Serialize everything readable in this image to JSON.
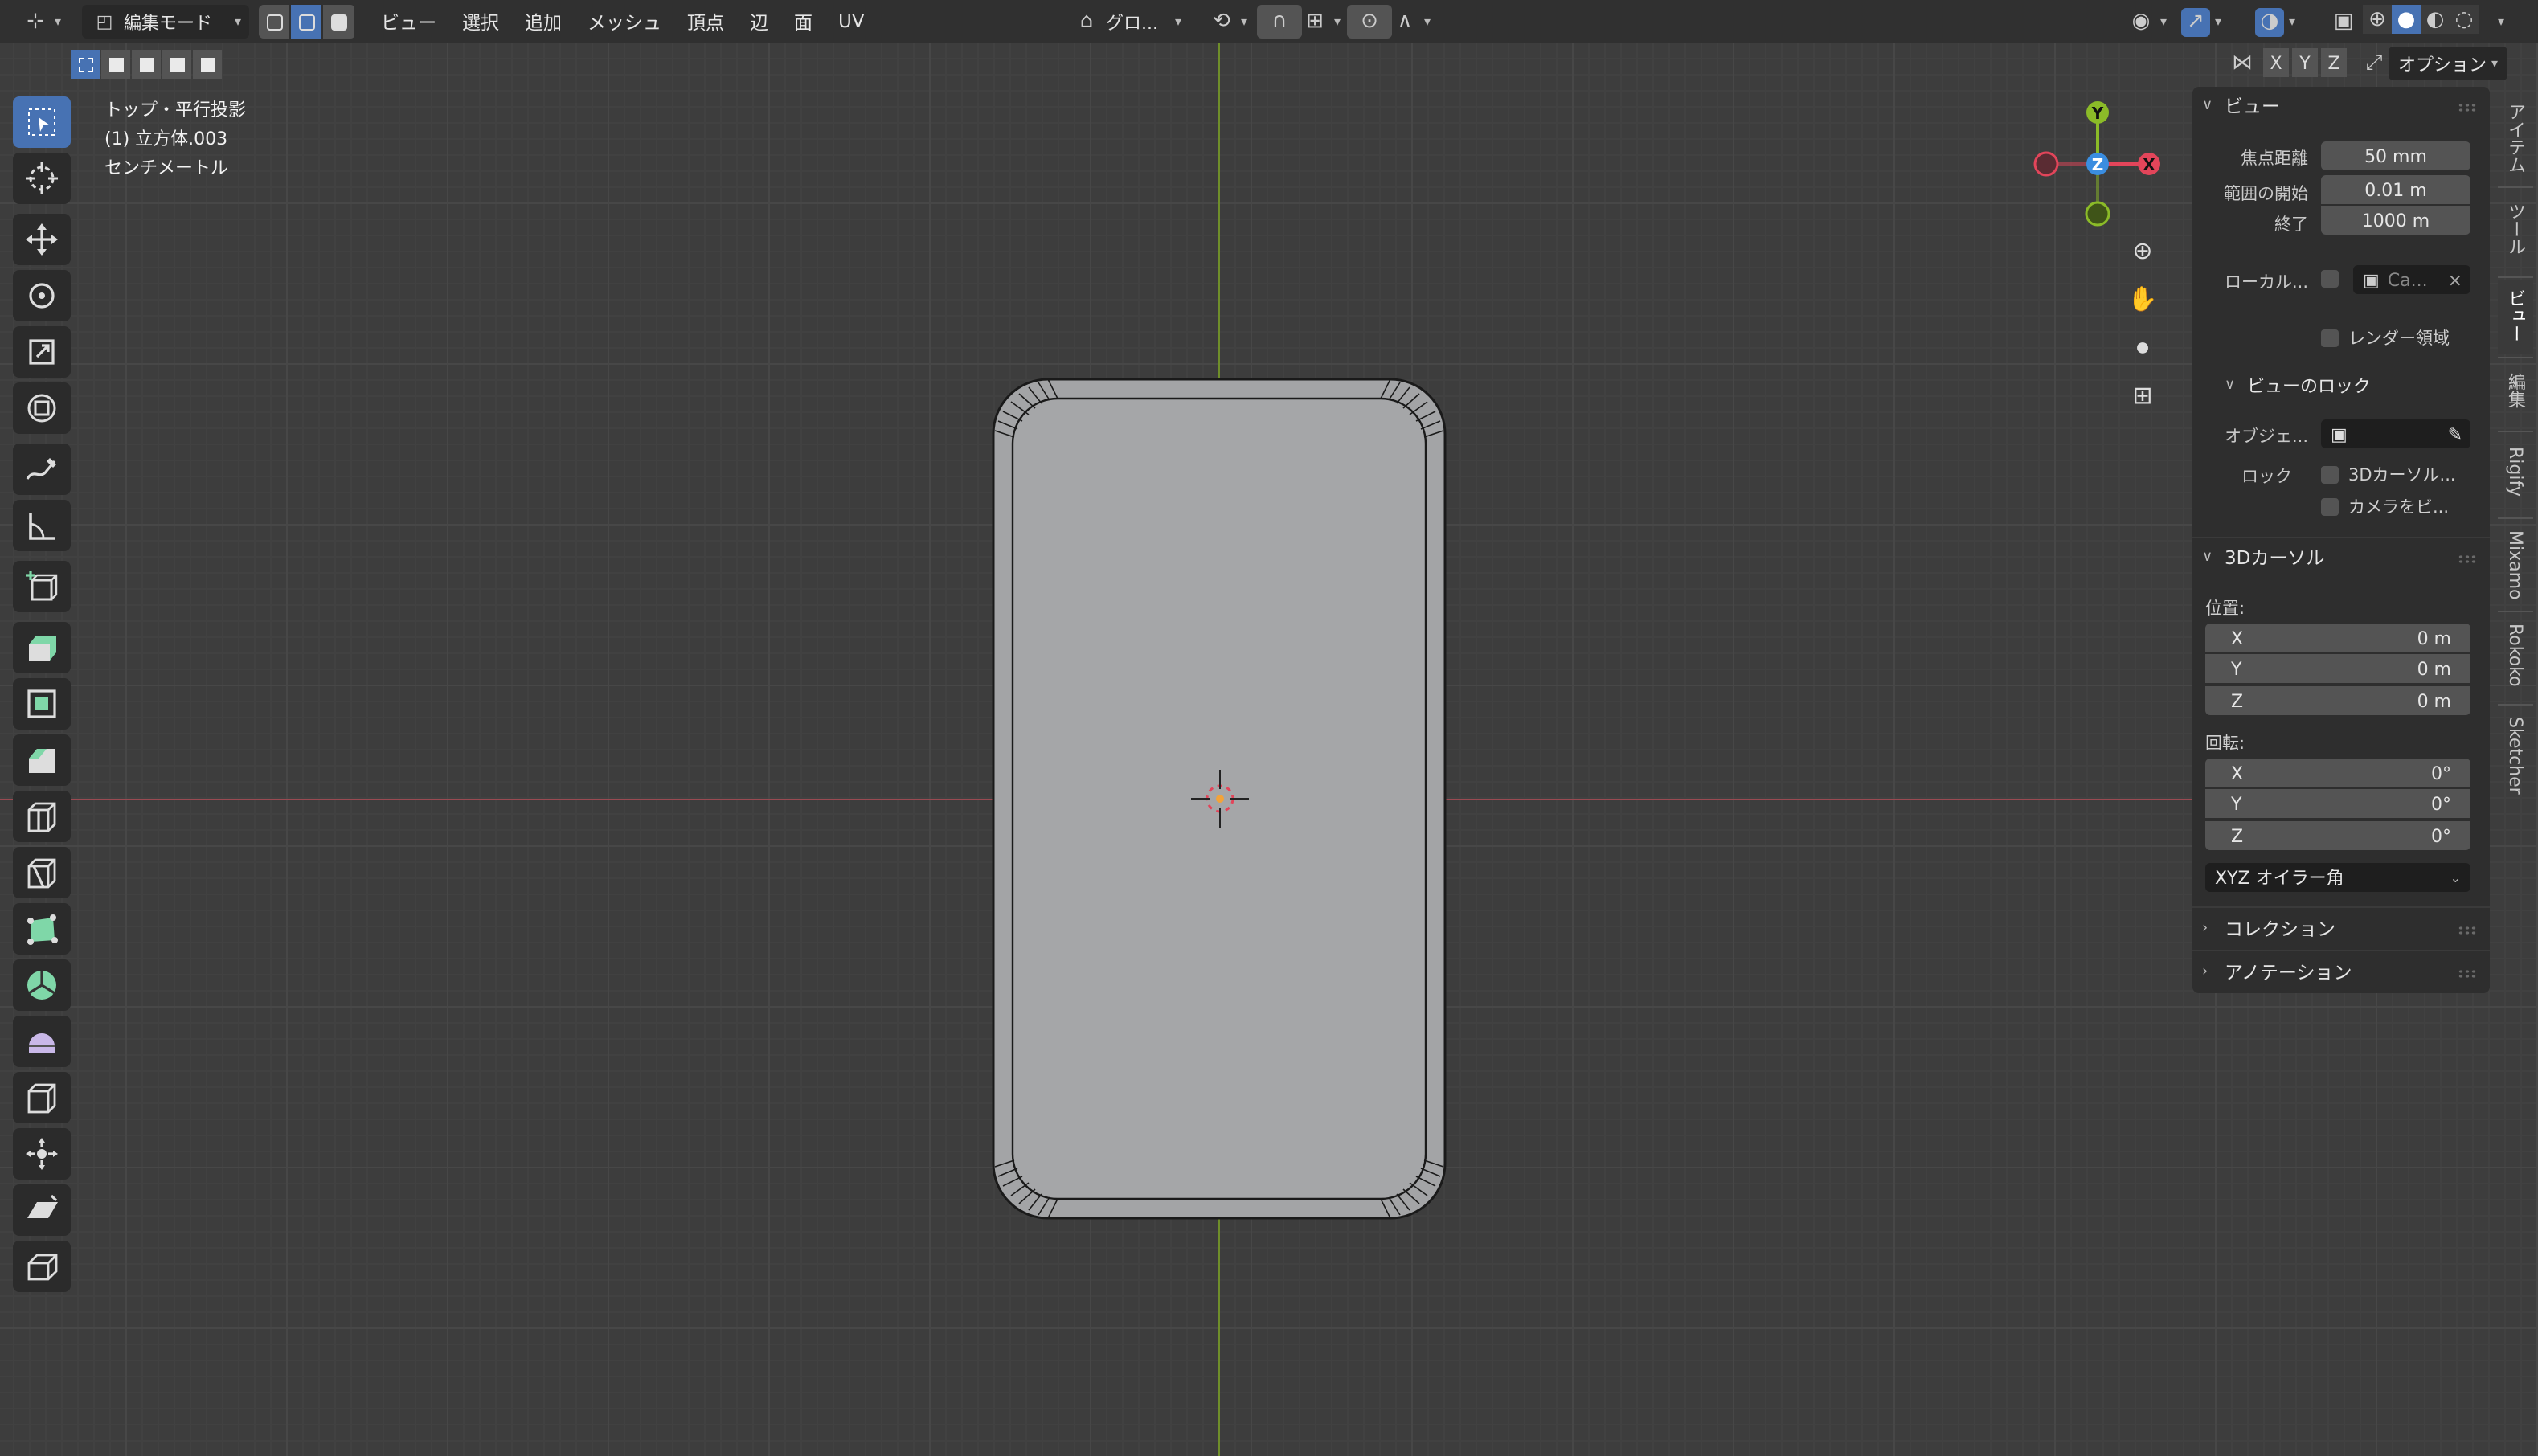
{
  "header": {
    "mode_label": "編集モード",
    "menus": [
      "ビュー",
      "選択",
      "追加",
      "メッシュ",
      "頂点",
      "辺",
      "面",
      "UV"
    ],
    "transform_orientation": "グロ..."
  },
  "subbar": {
    "axes": [
      "X",
      "Y",
      "Z"
    ],
    "options_label": "オプション"
  },
  "viewport_info": {
    "view_name": "トップ・平行投影",
    "object_name": "(1) 立方体.003",
    "units": "センチメートル"
  },
  "gizmo": {
    "x": "X",
    "y": "Y",
    "z": "Z"
  },
  "npanel": {
    "view_section": {
      "title": "ビュー",
      "focal_label": "焦点距離",
      "focal_value": "50 mm",
      "clip_start_label": "範囲の開始",
      "clip_start_value": "0.01 m",
      "clip_end_label": "終了",
      "clip_end_value": "1000 m",
      "local_camera_label": "ローカル...",
      "local_camera_value": "Ca...",
      "render_region_label": "レンダー領域",
      "view_lock_title": "ビューのロック",
      "lock_object_label": "オブジェ...",
      "lock_label": "ロック",
      "lock_to_cursor_label": "3Dカーソル...",
      "camera_to_view_label": "カメラをビ..."
    },
    "cursor_section": {
      "title": "3Dカーソル",
      "location_label": "位置:",
      "loc_x": "0 m",
      "loc_y": "0 m",
      "loc_z": "0 m",
      "rotation_label": "回転:",
      "rot_x": "0°",
      "rot_y": "0°",
      "rot_z": "0°",
      "axis_x": "X",
      "axis_y": "Y",
      "axis_z": "Z",
      "rotation_mode": "XYZ オイラー角"
    },
    "collection_title": "コレクション",
    "annotation_title": "アノテーション"
  },
  "tabs": [
    "アイテム",
    "ツール",
    "ビュー",
    "編集",
    "Rigify",
    "Mixamo",
    "Rokoko",
    "Sketcher"
  ],
  "colors": {
    "accent": "#4772b3",
    "axis_x": "#e2455a",
    "axis_y": "#8bbb28",
    "axis_z": "#3a8de0",
    "mesh_fill": "#a3a4a6"
  }
}
